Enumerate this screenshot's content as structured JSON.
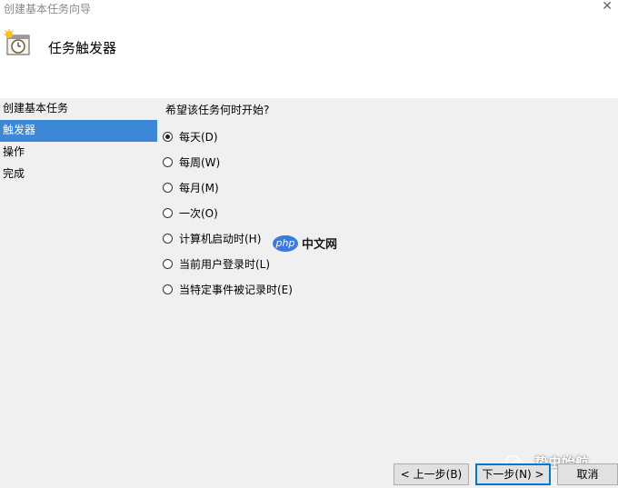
{
  "window": {
    "title": "创建基本任务向导",
    "close_glyph": "✕"
  },
  "header": {
    "title": "任务触发器",
    "icon": "clock-calendar-icon"
  },
  "sidebar": {
    "items": [
      {
        "label": "创建基本任务",
        "active": false
      },
      {
        "label": "触发器",
        "active": true
      },
      {
        "label": "操作",
        "active": false
      },
      {
        "label": "完成",
        "active": false
      }
    ]
  },
  "main": {
    "question": "希望该任务何时开始?",
    "options": [
      {
        "label": "每天(D)",
        "checked": true
      },
      {
        "label": "每周(W)",
        "checked": false
      },
      {
        "label": "每月(M)",
        "checked": false
      },
      {
        "label": "一次(O)",
        "checked": false
      },
      {
        "label": "计算机启动时(H)",
        "checked": false
      },
      {
        "label": "当前用户登录时(L)",
        "checked": false
      },
      {
        "label": "当特定事件被记录时(E)",
        "checked": false
      }
    ]
  },
  "buttons": {
    "back": "< 上一步(B)",
    "next": "下一步(N) >",
    "cancel": "取消"
  },
  "watermarks": {
    "php_badge": "php",
    "php_text": "中文网",
    "wechat_text": "蛰虫始航"
  },
  "colors": {
    "selection": "#3c88d7",
    "default_button_border": "#0078d7"
  }
}
